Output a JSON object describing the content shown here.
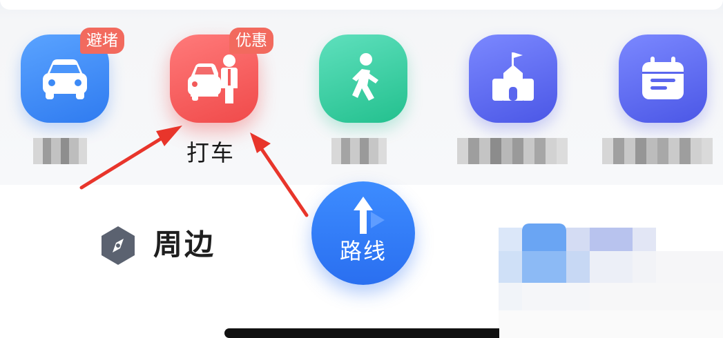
{
  "quick_actions": {
    "car": {
      "badge": "避堵",
      "icon": "car-icon",
      "color": "#2f7bf0"
    },
    "taxi": {
      "badge": "优惠",
      "label": "打车",
      "icon": "taxi-person-icon",
      "color": "#f04a4a"
    },
    "walk": {
      "icon": "walking-person-icon",
      "color": "#23c08e"
    },
    "school": {
      "icon": "school-building-icon",
      "color": "#4b57e6"
    },
    "calendar": {
      "icon": "calendar-icon",
      "color": "#4b57e6"
    }
  },
  "nearby": {
    "label": "周边",
    "icon": "compass-icon"
  },
  "route_button": {
    "label": "路线",
    "icon": "route-arrow-icon",
    "color": "#2a6ff0"
  },
  "annotation": {
    "arrow_color": "#e8352b"
  }
}
